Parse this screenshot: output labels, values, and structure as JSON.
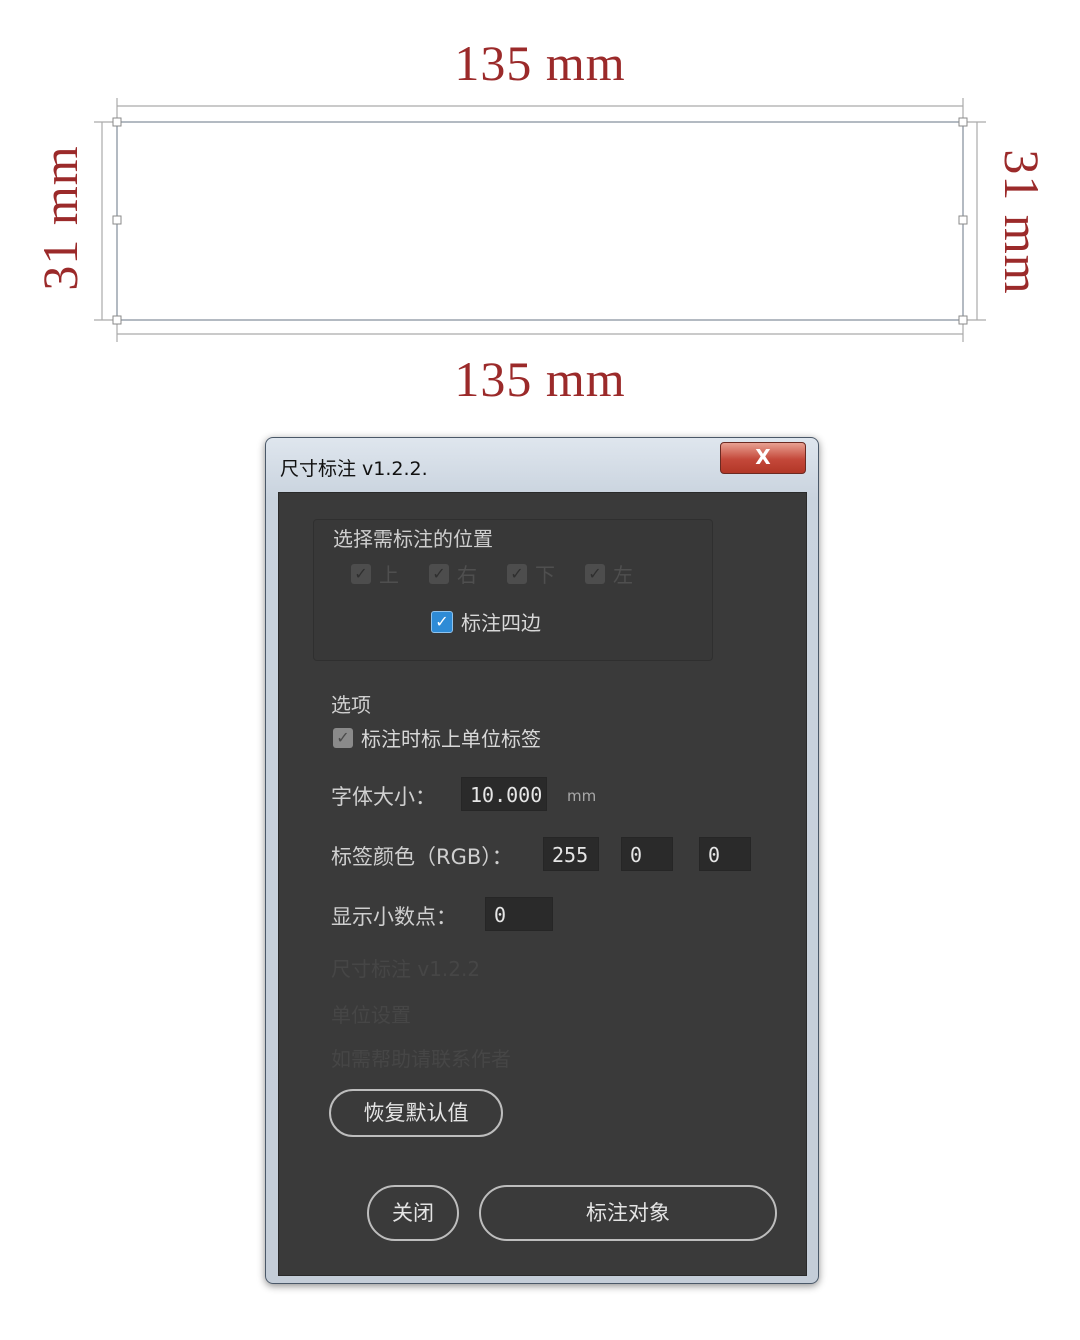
{
  "drawing": {
    "width_label": "135 mm",
    "height_label": "31 mm"
  },
  "dialog": {
    "title": "尺寸标注 v1.2.2.",
    "close_glyph": "X",
    "position_group": {
      "title": "选择需标注的位置",
      "sides": [
        "上",
        "右",
        "下",
        "左"
      ],
      "all_sides_label": "标注四边"
    },
    "options": {
      "title": "选项",
      "unit_label_checkbox": "标注时标上单位标签",
      "font_size_label": "字体大小：",
      "font_size_value": "10.000",
      "font_size_unit": "mm",
      "color_label": "标签颜色（RGB）：",
      "color_r": "255",
      "color_g": "0",
      "color_b": "0",
      "decimals_label": "显示小数点：",
      "decimals_value": "0"
    },
    "faded_lines": [
      "尺寸标注 v1.2.2",
      "单位设置",
      "如需帮助请联系作者"
    ],
    "reset_button": "恢复默认值",
    "close_button": "关闭",
    "apply_button": "标注对象"
  }
}
